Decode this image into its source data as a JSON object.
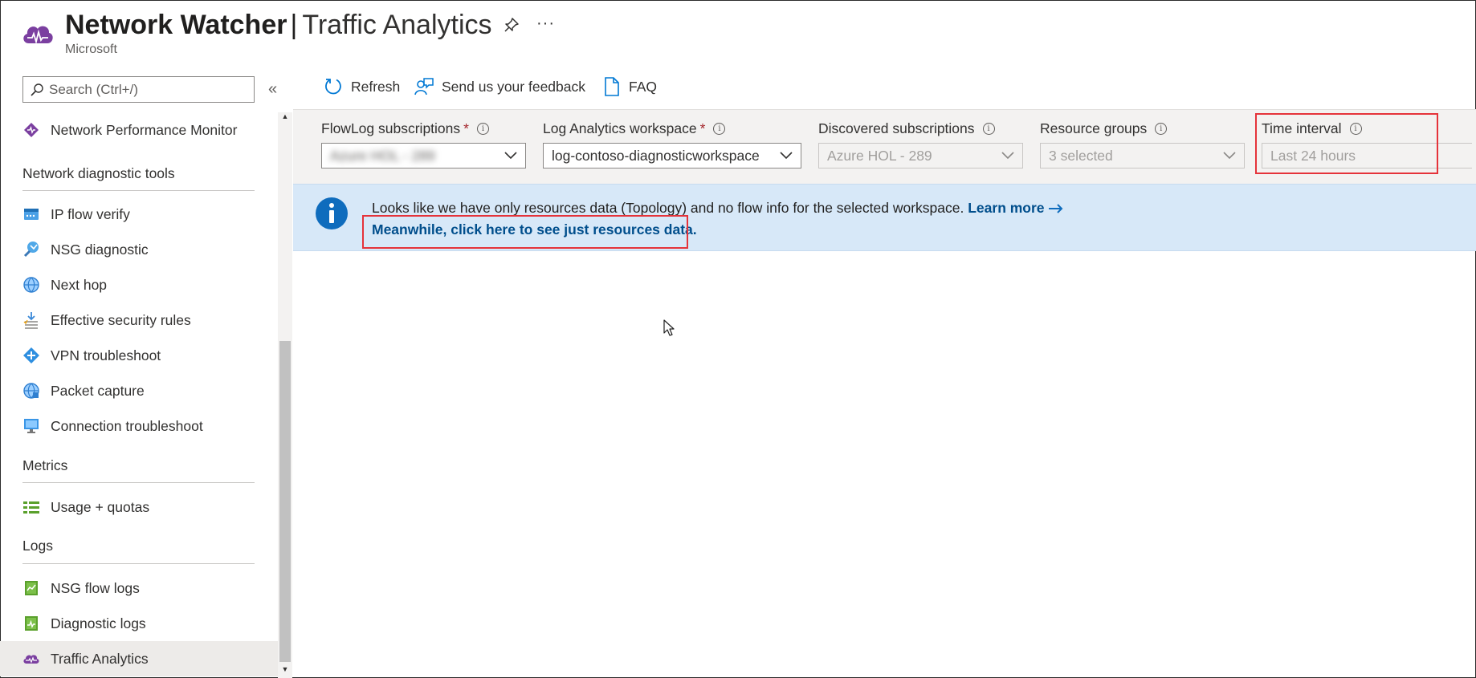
{
  "header": {
    "title_strong": "Network Watcher",
    "title_separator": "|",
    "title_light": "Traffic Analytics",
    "subtitle": "Microsoft",
    "more_label": "···"
  },
  "sidebar": {
    "search_placeholder": "Search (Ctrl+/)",
    "collapse_label": "«",
    "top_item": {
      "label": "Network Performance Monitor",
      "icon": "network-performance-monitor-icon"
    },
    "sections": [
      {
        "title": "Network diagnostic tools",
        "items": [
          {
            "label": "IP flow verify",
            "icon": "ip-flow-verify-icon"
          },
          {
            "label": "NSG diagnostic",
            "icon": "nsg-diagnostic-icon"
          },
          {
            "label": "Next hop",
            "icon": "next-hop-icon"
          },
          {
            "label": "Effective security rules",
            "icon": "effective-security-rules-icon"
          },
          {
            "label": "VPN troubleshoot",
            "icon": "vpn-troubleshoot-icon"
          },
          {
            "label": "Packet capture",
            "icon": "packet-capture-icon"
          },
          {
            "label": "Connection troubleshoot",
            "icon": "connection-troubleshoot-icon"
          }
        ]
      },
      {
        "title": "Metrics",
        "items": [
          {
            "label": "Usage + quotas",
            "icon": "usage-quotas-icon"
          }
        ]
      },
      {
        "title": "Logs",
        "items": [
          {
            "label": "NSG flow logs",
            "icon": "nsg-flow-logs-icon"
          },
          {
            "label": "Diagnostic logs",
            "icon": "diagnostic-logs-icon"
          },
          {
            "label": "Traffic Analytics",
            "icon": "traffic-analytics-icon",
            "active": true
          }
        ]
      }
    ]
  },
  "toolbar": {
    "refresh_label": "Refresh",
    "feedback_label": "Send us your feedback",
    "faq_label": "FAQ"
  },
  "filters": {
    "flowlog_subscriptions": {
      "label": "FlowLog subscriptions",
      "required_mark": "*",
      "value": "Azure HOL - 289"
    },
    "log_analytics_workspace": {
      "label": "Log Analytics workspace",
      "required_mark": "*",
      "value": "log-contoso-diagnosticworkspace"
    },
    "discovered_subscriptions": {
      "label": "Discovered subscriptions",
      "value": "Azure HOL - 289"
    },
    "resource_groups": {
      "label": "Resource groups",
      "value": "3 selected"
    },
    "time_interval": {
      "label": "Time interval",
      "value": "Last 24 hours"
    },
    "info_glyph": "i"
  },
  "banner": {
    "message": "Looks like we have only resources data (Topology) and no flow info for the selected workspace.",
    "learn_more": "Learn more",
    "resources_link": "Meanwhile, click here to see just resources data."
  },
  "colors": {
    "highlight": "#e5333a",
    "link": "#004e8c",
    "banner_bg": "#d7e8f8",
    "brand_purple": "#7b3fa0"
  }
}
